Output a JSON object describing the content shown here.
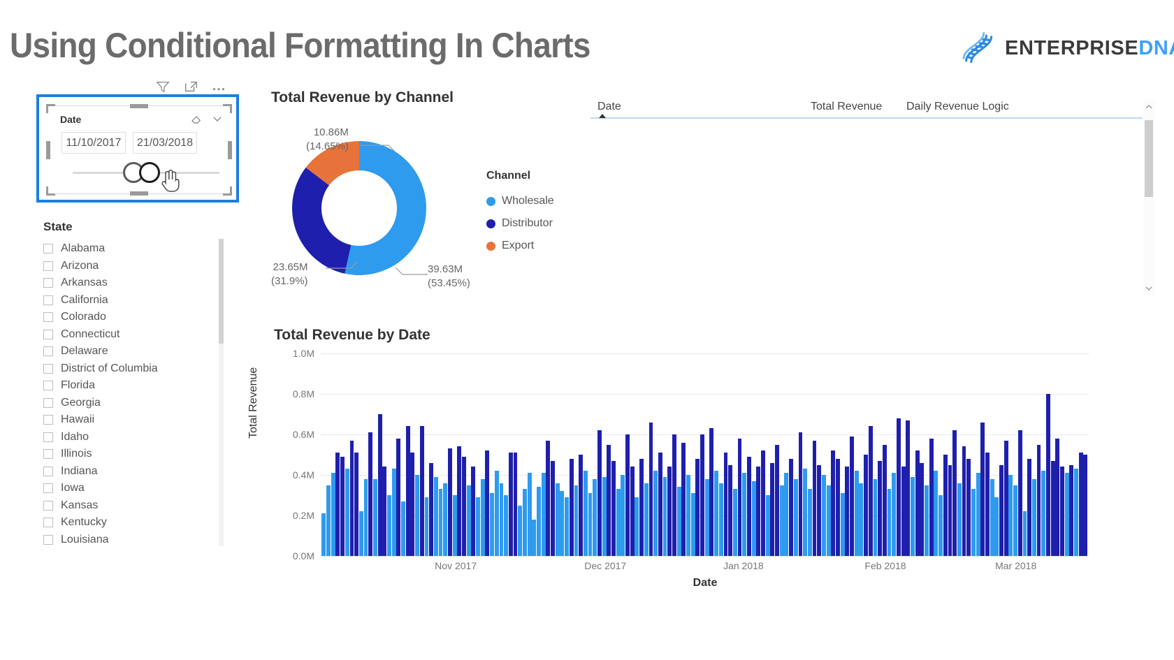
{
  "header": {
    "title": "Using Conditional Formatting In Charts",
    "brand_dark": "ENTERPRISE",
    "brand_blue": "DNA"
  },
  "date_slicer": {
    "title": "Date",
    "start_date": "11/10/2017",
    "end_date": "21/03/2018",
    "toolbar": [
      "filter-icon",
      "focus-mode-icon",
      "more-options-icon"
    ],
    "header_icons": [
      "eraser-icon",
      "chevron-down-icon"
    ]
  },
  "state_slicer": {
    "title": "State",
    "items": [
      "Alabama",
      "Arizona",
      "Arkansas",
      "California",
      "Colorado",
      "Connecticut",
      "Delaware",
      "District of Columbia",
      "Florida",
      "Georgia",
      "Hawaii",
      "Idaho",
      "Illinois",
      "Indiana",
      "Iowa",
      "Kansas",
      "Kentucky",
      "Louisiana"
    ]
  },
  "table": {
    "columns": [
      "Date",
      "Total Revenue",
      "Daily Revenue Logic"
    ],
    "sort_column": "Date",
    "sort_direction": "ascending",
    "rows": []
  },
  "colors": {
    "wholesale": "#2E9BEF",
    "distributor": "#1F1FAD",
    "export": "#E8733A",
    "title_gray": "#6b6b6b",
    "accent_blue": "#1a7fe0"
  },
  "chart_data": [
    {
      "type": "pie",
      "title": "Total Revenue by Channel",
      "legend_title": "Channel",
      "legend_position": "right",
      "categories": [
        "Wholesale",
        "Distributor",
        "Export"
      ],
      "values": [
        39.63,
        23.65,
        10.86
      ],
      "percents": [
        53.45,
        31.9,
        14.65
      ],
      "value_unit": "M",
      "data_labels": [
        "39.63M\n(53.45%)",
        "23.65M\n(31.9%)",
        "10.86M\n(14.65%)"
      ],
      "colors": [
        "#2E9BEF",
        "#1F1FAD",
        "#E8733A"
      ],
      "donut": true
    },
    {
      "type": "bar",
      "title": "Total Revenue by Date",
      "xlabel": "Date",
      "ylabel": "Total Revenue",
      "ylim": [
        0,
        1.0
      ],
      "yticks": [
        "0.0M",
        "0.2M",
        "0.4M",
        "0.6M",
        "0.8M",
        "1.0M"
      ],
      "ytick_values": [
        0.0,
        0.2,
        0.4,
        0.6,
        0.8,
        1.0
      ],
      "xticks": [
        "Nov 2017",
        "Dec 2017",
        "Jan 2018",
        "Feb 2018",
        "Mar 2018"
      ],
      "xtick_positions_pct": [
        17.5,
        37.0,
        55.0,
        73.5,
        90.5
      ],
      "grid": true,
      "conditional_colors": {
        "high": "#1F1FAD",
        "low": "#2E9BEF"
      },
      "values": [
        0.21,
        0.35,
        0.41,
        0.51,
        0.49,
        0.43,
        0.57,
        0.51,
        0.22,
        0.38,
        0.61,
        0.38,
        0.7,
        0.44,
        0.3,
        0.43,
        0.58,
        0.27,
        0.64,
        0.51,
        0.4,
        0.64,
        0.29,
        0.46,
        0.39,
        0.33,
        0.36,
        0.53,
        0.3,
        0.54,
        0.49,
        0.35,
        0.44,
        0.29,
        0.38,
        0.52,
        0.31,
        0.42,
        0.36,
        0.3,
        0.51,
        0.51,
        0.25,
        0.33,
        0.41,
        0.18,
        0.34,
        0.41,
        0.57,
        0.47,
        0.36,
        0.32,
        0.29,
        0.48,
        0.35,
        0.5,
        0.42,
        0.31,
        0.38,
        0.62,
        0.39,
        0.55,
        0.47,
        0.33,
        0.4,
        0.6,
        0.44,
        0.29,
        0.48,
        0.36,
        0.66,
        0.42,
        0.51,
        0.39,
        0.44,
        0.6,
        0.34,
        0.56,
        0.4,
        0.31,
        0.48,
        0.6,
        0.38,
        0.63,
        0.42,
        0.36,
        0.51,
        0.45,
        0.33,
        0.58,
        0.41,
        0.49,
        0.37,
        0.44,
        0.52,
        0.3,
        0.46,
        0.55,
        0.35,
        0.41,
        0.48,
        0.38,
        0.61,
        0.43,
        0.33,
        0.57,
        0.45,
        0.4,
        0.35,
        0.52,
        0.48,
        0.31,
        0.44,
        0.59,
        0.42,
        0.36,
        0.5,
        0.64,
        0.38,
        0.47,
        0.55,
        0.33,
        0.41,
        0.68,
        0.44,
        0.67,
        0.39,
        0.52,
        0.46,
        0.35,
        0.58,
        0.42,
        0.3,
        0.5,
        0.45,
        0.62,
        0.36,
        0.54,
        0.48,
        0.33,
        0.41,
        0.66,
        0.51,
        0.38,
        0.29,
        0.45,
        0.57,
        0.4,
        0.35,
        0.62,
        0.22,
        0.48,
        0.38,
        0.55,
        0.42,
        0.8,
        0.47,
        0.58,
        0.44,
        0.41,
        0.45,
        0.43,
        0.51,
        0.5
      ]
    }
  ]
}
